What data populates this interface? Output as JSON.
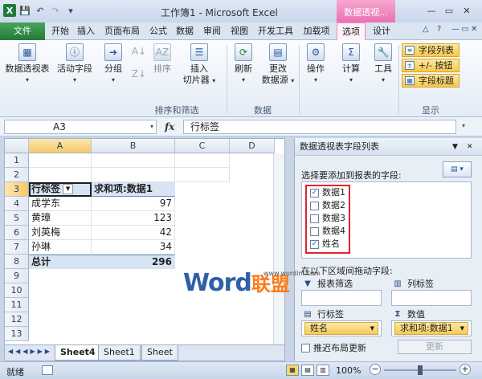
{
  "window": {
    "title": "工作簿1 - Microsoft Excel",
    "context_tab": "数据透视...",
    "minimize": "—",
    "restore": "▭",
    "close": "✕"
  },
  "tabs": [
    "文件",
    "开始",
    "插入",
    "页面布局",
    "公式",
    "数据",
    "审阅",
    "视图",
    "开发工具",
    "加载项",
    "选项",
    "设计"
  ],
  "active_tab": "选项",
  "ribbon": {
    "buttons": {
      "pivot_table": "数据透视表",
      "active_field": "活动字段",
      "group": "分组",
      "sort": "排序",
      "insert_slicer_1": "插入",
      "insert_slicer_2": "切片器",
      "refresh": "刷新",
      "change_source_1": "更改",
      "change_source_2": "数据源",
      "actions": "操作",
      "calculations": "计算",
      "tools": "工具"
    },
    "groups": {
      "sort_filter": "排序和筛选",
      "data": "数据",
      "show": "显示"
    },
    "show_buttons": [
      "字段列表",
      "+/- 按钮",
      "字段标题"
    ]
  },
  "formula_bar": {
    "name_box": "A3",
    "fx": "fx",
    "formula": "行标签"
  },
  "grid": {
    "columns": [
      "A",
      "B",
      "C",
      "D"
    ],
    "rows": [
      "1",
      "2",
      "3",
      "4",
      "5",
      "6",
      "7",
      "8",
      "9",
      "10",
      "11",
      "12",
      "13"
    ],
    "header_row": {
      "a": "行标签",
      "b": "求和项:数据1"
    },
    "data_rows": [
      {
        "name": "成学东",
        "value": "97"
      },
      {
        "name": "黄璋",
        "value": "123"
      },
      {
        "name": "刘英梅",
        "value": "42"
      },
      {
        "name": "孙琳",
        "value": "34"
      }
    ],
    "total": {
      "name": "总计",
      "value": "296"
    }
  },
  "sheets": [
    "Sheet4",
    "Sheet1",
    "Sheet"
  ],
  "status": {
    "ready": "就绪",
    "zoom": "100%",
    "zoom_percent": 100
  },
  "pane": {
    "title": "数据透视表字段列表",
    "prompt": "选择要添加到报表的字段:",
    "fields": [
      {
        "label": "数据1",
        "checked": true
      },
      {
        "label": "数据2",
        "checked": false
      },
      {
        "label": "数据3",
        "checked": false
      },
      {
        "label": "数据4",
        "checked": false
      },
      {
        "label": "姓名",
        "checked": true
      }
    ],
    "drag_prompt": "在以下区域间拖动字段:",
    "areas": {
      "report_filter": "报表筛选",
      "column_labels": "列标签",
      "row_labels": "行标签",
      "values": "数值"
    },
    "row_pill": "姓名",
    "value_pill": "求和项:数据1",
    "defer_update": "推迟布局更新",
    "update_button": "更新"
  },
  "watermark": {
    "brand": "Word",
    "brand_cn": "联盟",
    "url": "www.wordlm.com"
  }
}
